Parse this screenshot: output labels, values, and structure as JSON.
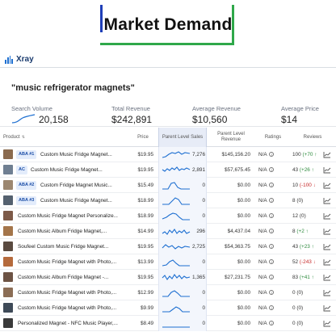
{
  "header": {
    "title": "Market Demand",
    "frame_colors": {
      "left_top": "#1f3fb8",
      "right_bottom": "#2fa84a"
    }
  },
  "app": {
    "logo_icon": "bar-chart-icon",
    "name": "Xray"
  },
  "keyword": "\"music refrigerator magnets\"",
  "stats": {
    "search_volume": {
      "label": "Search Volume",
      "value": "20,158"
    },
    "total_revenue": {
      "label": "Total Revenue",
      "value": "$242,891"
    },
    "average_revenue": {
      "label": "Average Revenue",
      "value": "$10,560"
    },
    "average_price": {
      "label": "Average Price",
      "value": "$14"
    }
  },
  "table": {
    "columns": {
      "product": "Product",
      "price": "Price",
      "sales": "Parent Level Sales",
      "revenue": "Parent Level Revenue",
      "ratings": "Ratings",
      "reviews": "Reviews"
    },
    "rows": [
      {
        "badge": "ABA #1",
        "name": "Custom Music Fridge Magnet...",
        "price": "$19.95",
        "sales": "7,276",
        "revenue": "$145,156.20",
        "rating": "N/A",
        "reviews": "100",
        "delta": "(+70",
        "trend": "up",
        "thumb": "#8a6a4e"
      },
      {
        "badge": "AC",
        "name": "Custom Music Fridge Magnet...",
        "price": "$19.95",
        "sales": "2,891",
        "revenue": "$57,675.45",
        "rating": "N/A",
        "reviews": "43",
        "delta": "(+26",
        "trend": "up",
        "thumb": "#6f7f92"
      },
      {
        "badge": "ABA #2",
        "name": "Custom Fridge Magnet Music...",
        "price": "$15.49",
        "sales": "0",
        "revenue": "$0.00",
        "rating": "N/A",
        "reviews": "10",
        "delta": "(-100",
        "trend": "down",
        "thumb": "#9c8770"
      },
      {
        "badge": "ABA #3",
        "name": "Custom Music Fridge Magnet...",
        "price": "$18.99",
        "sales": "0",
        "revenue": "$0.00",
        "rating": "N/A",
        "reviews": "8",
        "delta": "(0)",
        "trend": "none",
        "thumb": "#54616f"
      },
      {
        "badge": "",
        "name": "Custom Music Fridge Magnet Personalize...",
        "price": "$18.99",
        "sales": "0",
        "revenue": "$0.00",
        "rating": "N/A",
        "reviews": "12",
        "delta": "(0)",
        "trend": "none",
        "thumb": "#7d5a48"
      },
      {
        "badge": "",
        "name": "Custom Music Album Fridge Magnet,...",
        "price": "$14.99",
        "sales": "296",
        "revenue": "$4,437.04",
        "rating": "N/A",
        "reviews": "8",
        "delta": "(+2",
        "trend": "up",
        "thumb": "#a4754a"
      },
      {
        "badge": "",
        "name": "Soufeel Custom Music Fridge Magnet...",
        "price": "$19.95",
        "sales": "2,725",
        "revenue": "$54,363.75",
        "rating": "N/A",
        "reviews": "43",
        "delta": "(+23",
        "trend": "up",
        "thumb": "#5a4a40"
      },
      {
        "badge": "",
        "name": "Custom Music Fridge Magnet with Photo,...",
        "price": "$13.99",
        "sales": "0",
        "revenue": "$0.00",
        "rating": "N/A",
        "reviews": "52",
        "delta": "(-243",
        "trend": "down",
        "thumb": "#b56a3c"
      },
      {
        "badge": "",
        "name": "Custom Music Album Fridge Magnet -...",
        "price": "$19.95",
        "sales": "1,365",
        "revenue": "$27,231.75",
        "rating": "N/A",
        "reviews": "83",
        "delta": "(+41",
        "trend": "up",
        "thumb": "#6d5344"
      },
      {
        "badge": "",
        "name": "Custom Music Fridge Magnet with Photo,...",
        "price": "$12.99",
        "sales": "0",
        "revenue": "$0.00",
        "rating": "N/A",
        "reviews": "0",
        "delta": "(0)",
        "trend": "none",
        "thumb": "#8b6d55"
      },
      {
        "badge": "",
        "name": "Custom Music Fridge Magnet with Photo,...",
        "price": "$9.99",
        "sales": "0",
        "revenue": "$0.00",
        "rating": "N/A",
        "reviews": "0",
        "delta": "(0)",
        "trend": "none",
        "thumb": "#3e4a58"
      },
      {
        "badge": "",
        "name": "Personalized Magnet - NFC Music Player,...",
        "price": "$8.49",
        "sales": "0",
        "revenue": "$0.00",
        "rating": "N/A",
        "reviews": "0",
        "delta": "(0)",
        "trend": "none",
        "thumb": "#3a3a3a"
      }
    ]
  },
  "colors": {
    "accent": "#1d6fd1",
    "up": "#2e8b3e",
    "down": "#c62828",
    "sales_column_bg": "#f3f6fc"
  }
}
